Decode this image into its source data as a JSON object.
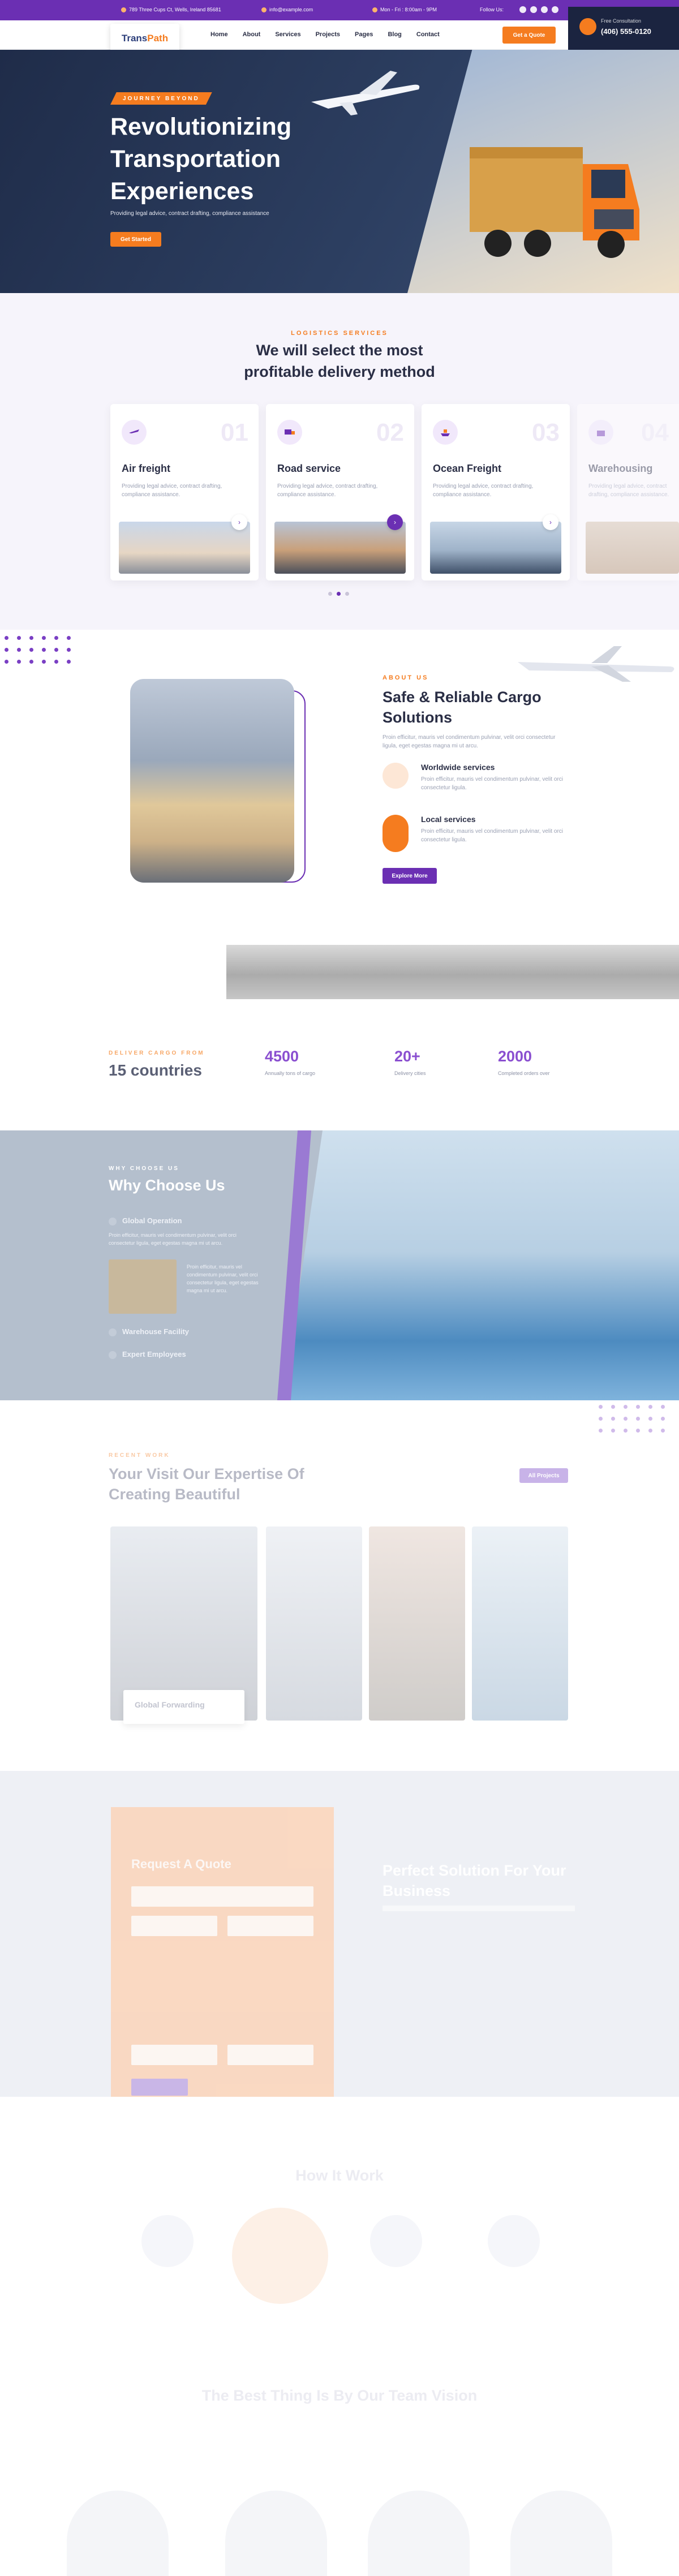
{
  "topbar": {
    "address": "789 Three Cups Ct, Wells, Ireland 85681",
    "email": "info@example.com",
    "hours": "Mon - Fri : 8:00am - 9PM",
    "follow": "Follow Us:"
  },
  "call": {
    "label": "Free Consultation",
    "number": "(406) 555-0120"
  },
  "logo": {
    "part1": "Trans",
    "part2": "Path"
  },
  "nav": [
    "Home",
    "About",
    "Services",
    "Projects",
    "Pages",
    "Blog",
    "Contact"
  ],
  "header": {
    "quote_btn": "Get a Quote"
  },
  "hero": {
    "eyebrow": "JOURNEY BEYOND",
    "title": "Revolutionizing Transportation Experiences",
    "subtitle": "Providing legal advice, contract drafting, compliance assistance",
    "button": "Get Started"
  },
  "services": {
    "eyebrow": "LOGISTICS SERVICES",
    "title": "We will select the most profitable delivery method",
    "cards": [
      {
        "num": "01",
        "title": "Air freight",
        "desc": "Providing legal advice, contract drafting, compliance assistance."
      },
      {
        "num": "02",
        "title": "Road service",
        "desc": "Providing legal advice, contract drafting, compliance assistance."
      },
      {
        "num": "03",
        "title": "Ocean Freight",
        "desc": "Providing legal advice, contract drafting, compliance assistance."
      },
      {
        "num": "04",
        "title": "Warehousing",
        "desc": "Providing legal advice, contract drafting, compliance assistance."
      }
    ]
  },
  "about": {
    "eyebrow": "ABOUT US",
    "title": "Safe & Reliable Cargo Solutions",
    "text": "Proin efficitur, mauris vel condimentum pulvinar, velit orci consectetur ligula, eget egestas magna mi ut arcu.",
    "items": [
      {
        "title": "Worldwide services",
        "desc": "Proin efficitur, mauris vel condimentum pulvinar, velit orci consectetur ligula."
      },
      {
        "title": "Local services",
        "desc": "Proin efficitur, mauris vel condimentum pulvinar, velit orci consectetur ligula."
      }
    ],
    "button": "Explore More"
  },
  "stats": {
    "eyebrow": "DELIVER CARGO FROM",
    "countries": "15 countries",
    "items": [
      {
        "value": "4500",
        "label": "Annually tons of cargo"
      },
      {
        "value": "20+",
        "label": "Delivery cities"
      },
      {
        "value": "2000",
        "label": "Completed orders over"
      }
    ]
  },
  "why": {
    "eyebrow": "WHY CHOOSE US",
    "title": "Why Choose Us",
    "items": [
      "Global Operation",
      "Warehouse Facility",
      "Expert Employees"
    ],
    "text": "Proin efficitur, mauris vel condimentum pulvinar, velit orci consectetur ligula, eget egestas magna mi ut arcu.",
    "side": "Proin efficitur, mauris vel condimentum pulvinar, velit orci consectetur ligula, eget egestas magna mi ut arcu."
  },
  "recent": {
    "eyebrow": "RECENT WORK",
    "title": "Your Visit Our Expertise Of Creating Beautiful",
    "button": "All Projects",
    "label": "Global Forwarding"
  },
  "contact": {
    "form_title": "Request A Quote",
    "right_title": "Perfect Solution For Your Business"
  },
  "how": {
    "title": "How It Work"
  },
  "team": {
    "title": "The Best Thing Is By Our Team Vision"
  },
  "colors": {
    "purple": "#6b2fb3",
    "orange": "#f57c1f",
    "navy": "#1b2440"
  }
}
